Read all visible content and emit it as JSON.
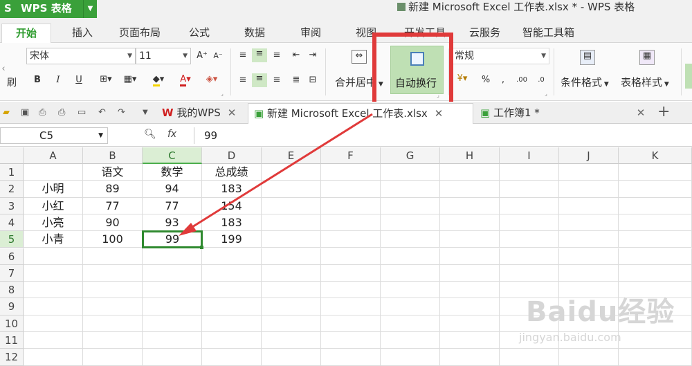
{
  "app": {
    "name": "WPS 表格",
    "logo_letter": "S"
  },
  "window_title": "新建 Microsoft Excel 工作表.xlsx * - WPS 表格",
  "menu": {
    "items": [
      "开始",
      "插入",
      "页面布局",
      "公式",
      "数据",
      "审阅",
      "视图",
      "开发工具",
      "云服务",
      "智能工具箱"
    ]
  },
  "ribbon": {
    "font_name": "宋体",
    "font_size": "11",
    "bold": "B",
    "italic": "I",
    "underline": "U",
    "merge_center": "合并居中",
    "wrap_text": "自动换行",
    "number_format": "常规",
    "percent": "%",
    "comma": ",",
    "conditional_format": "条件格式",
    "table_style": "表格样式",
    "left_edge_label": "刷"
  },
  "tabs": [
    {
      "label": "我的WPS",
      "active": false
    },
    {
      "label": "新建 Microsoft Excel 工作表.xlsx",
      "active": true
    },
    {
      "label": "工作簿1 *",
      "active": false
    }
  ],
  "formula_bar": {
    "cell_ref": "C5",
    "fx": "fx",
    "value": "99"
  },
  "sheet": {
    "columns": [
      "A",
      "B",
      "C",
      "D",
      "E",
      "F",
      "G",
      "H",
      "I",
      "J",
      "K"
    ],
    "rows": [
      "1",
      "2",
      "3",
      "4",
      "5",
      "6",
      "7",
      "8",
      "9",
      "10",
      "11",
      "12"
    ],
    "cells": [
      [
        "",
        "语文",
        "数学",
        "总成绩"
      ],
      [
        "小明",
        "89",
        "94",
        "183"
      ],
      [
        "小红",
        "77",
        "77",
        "154"
      ],
      [
        "小亮",
        "90",
        "93",
        "183"
      ],
      [
        "小青",
        "100",
        "99",
        "199"
      ]
    ],
    "selected_cell": "C5"
  },
  "watermark": {
    "text": "Baidu经验",
    "url": "jingyan.baidu.com"
  },
  "colors": {
    "accent": "#3aa03a",
    "highlight_box": "#e03a3a",
    "arrow": "#e03a3a"
  }
}
